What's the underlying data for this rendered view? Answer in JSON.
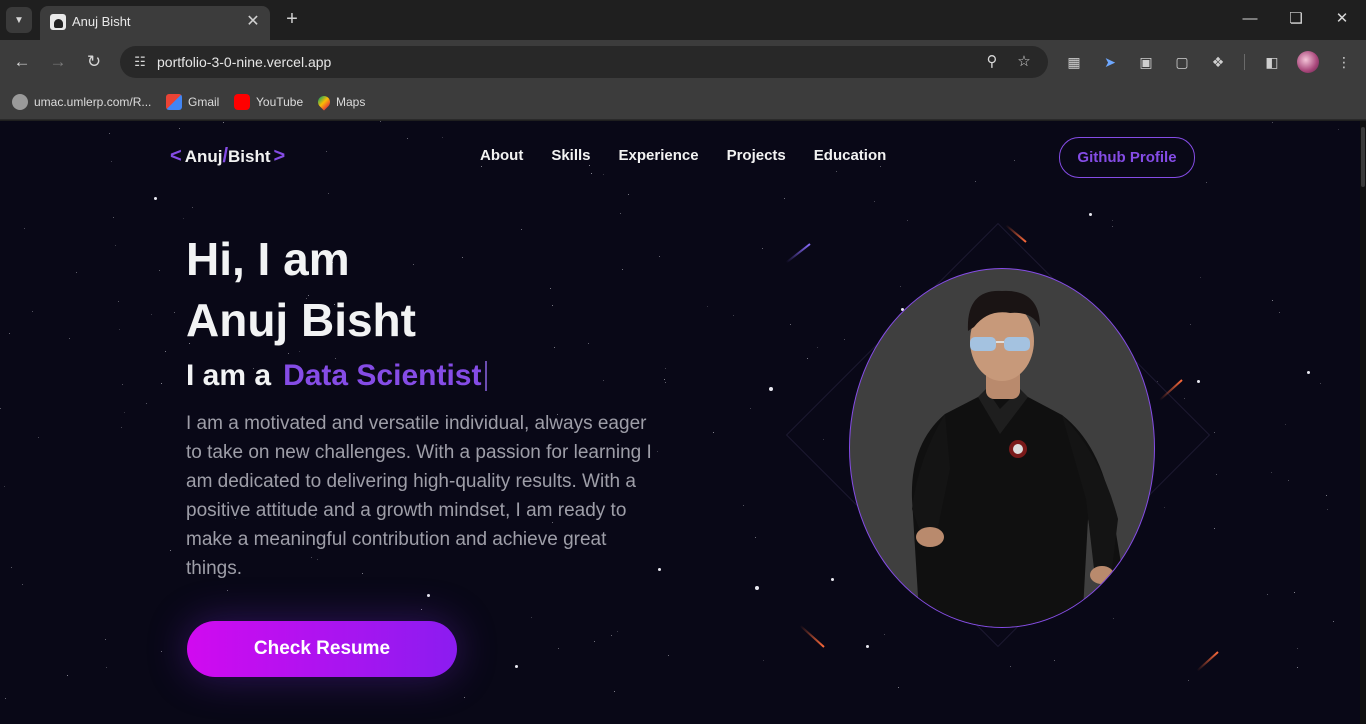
{
  "browser": {
    "tab_title": "Anuj Bisht",
    "url": "portfolio-3-0-nine.vercel.app",
    "bookmarks": [
      {
        "label": "umac.umlerp.com/R...",
        "icon": "globe-icon"
      },
      {
        "label": "Gmail",
        "icon": "gmail-icon"
      },
      {
        "label": "YouTube",
        "icon": "youtube-icon"
      },
      {
        "label": "Maps",
        "icon": "maps-icon"
      }
    ]
  },
  "navbar": {
    "logo_open": "<",
    "logo_first": "Anuj",
    "logo_slash": "/",
    "logo_last": "Bisht",
    "logo_close": ">",
    "links": [
      "About",
      "Skills",
      "Experience",
      "Projects",
      "Education"
    ],
    "github_label": "Github Profile"
  },
  "hero": {
    "greeting": "Hi, I am",
    "name": "Anuj Bisht",
    "role_prefix": "I am a",
    "role": "Data Scientist",
    "bio": "I am a motivated and versatile individual, always eager to take on new challenges. With a passion for learning I am dedicated to delivering high-quality results. With a positive attitude and a growth mindset, I am ready to make a meaningful contribution and achieve great things.",
    "resume_label": "Check Resume"
  },
  "colors": {
    "accent": "#854ce6",
    "background": "#090817",
    "button_gradient_start": "#d10af0",
    "button_gradient_end": "#8b1cf0"
  }
}
